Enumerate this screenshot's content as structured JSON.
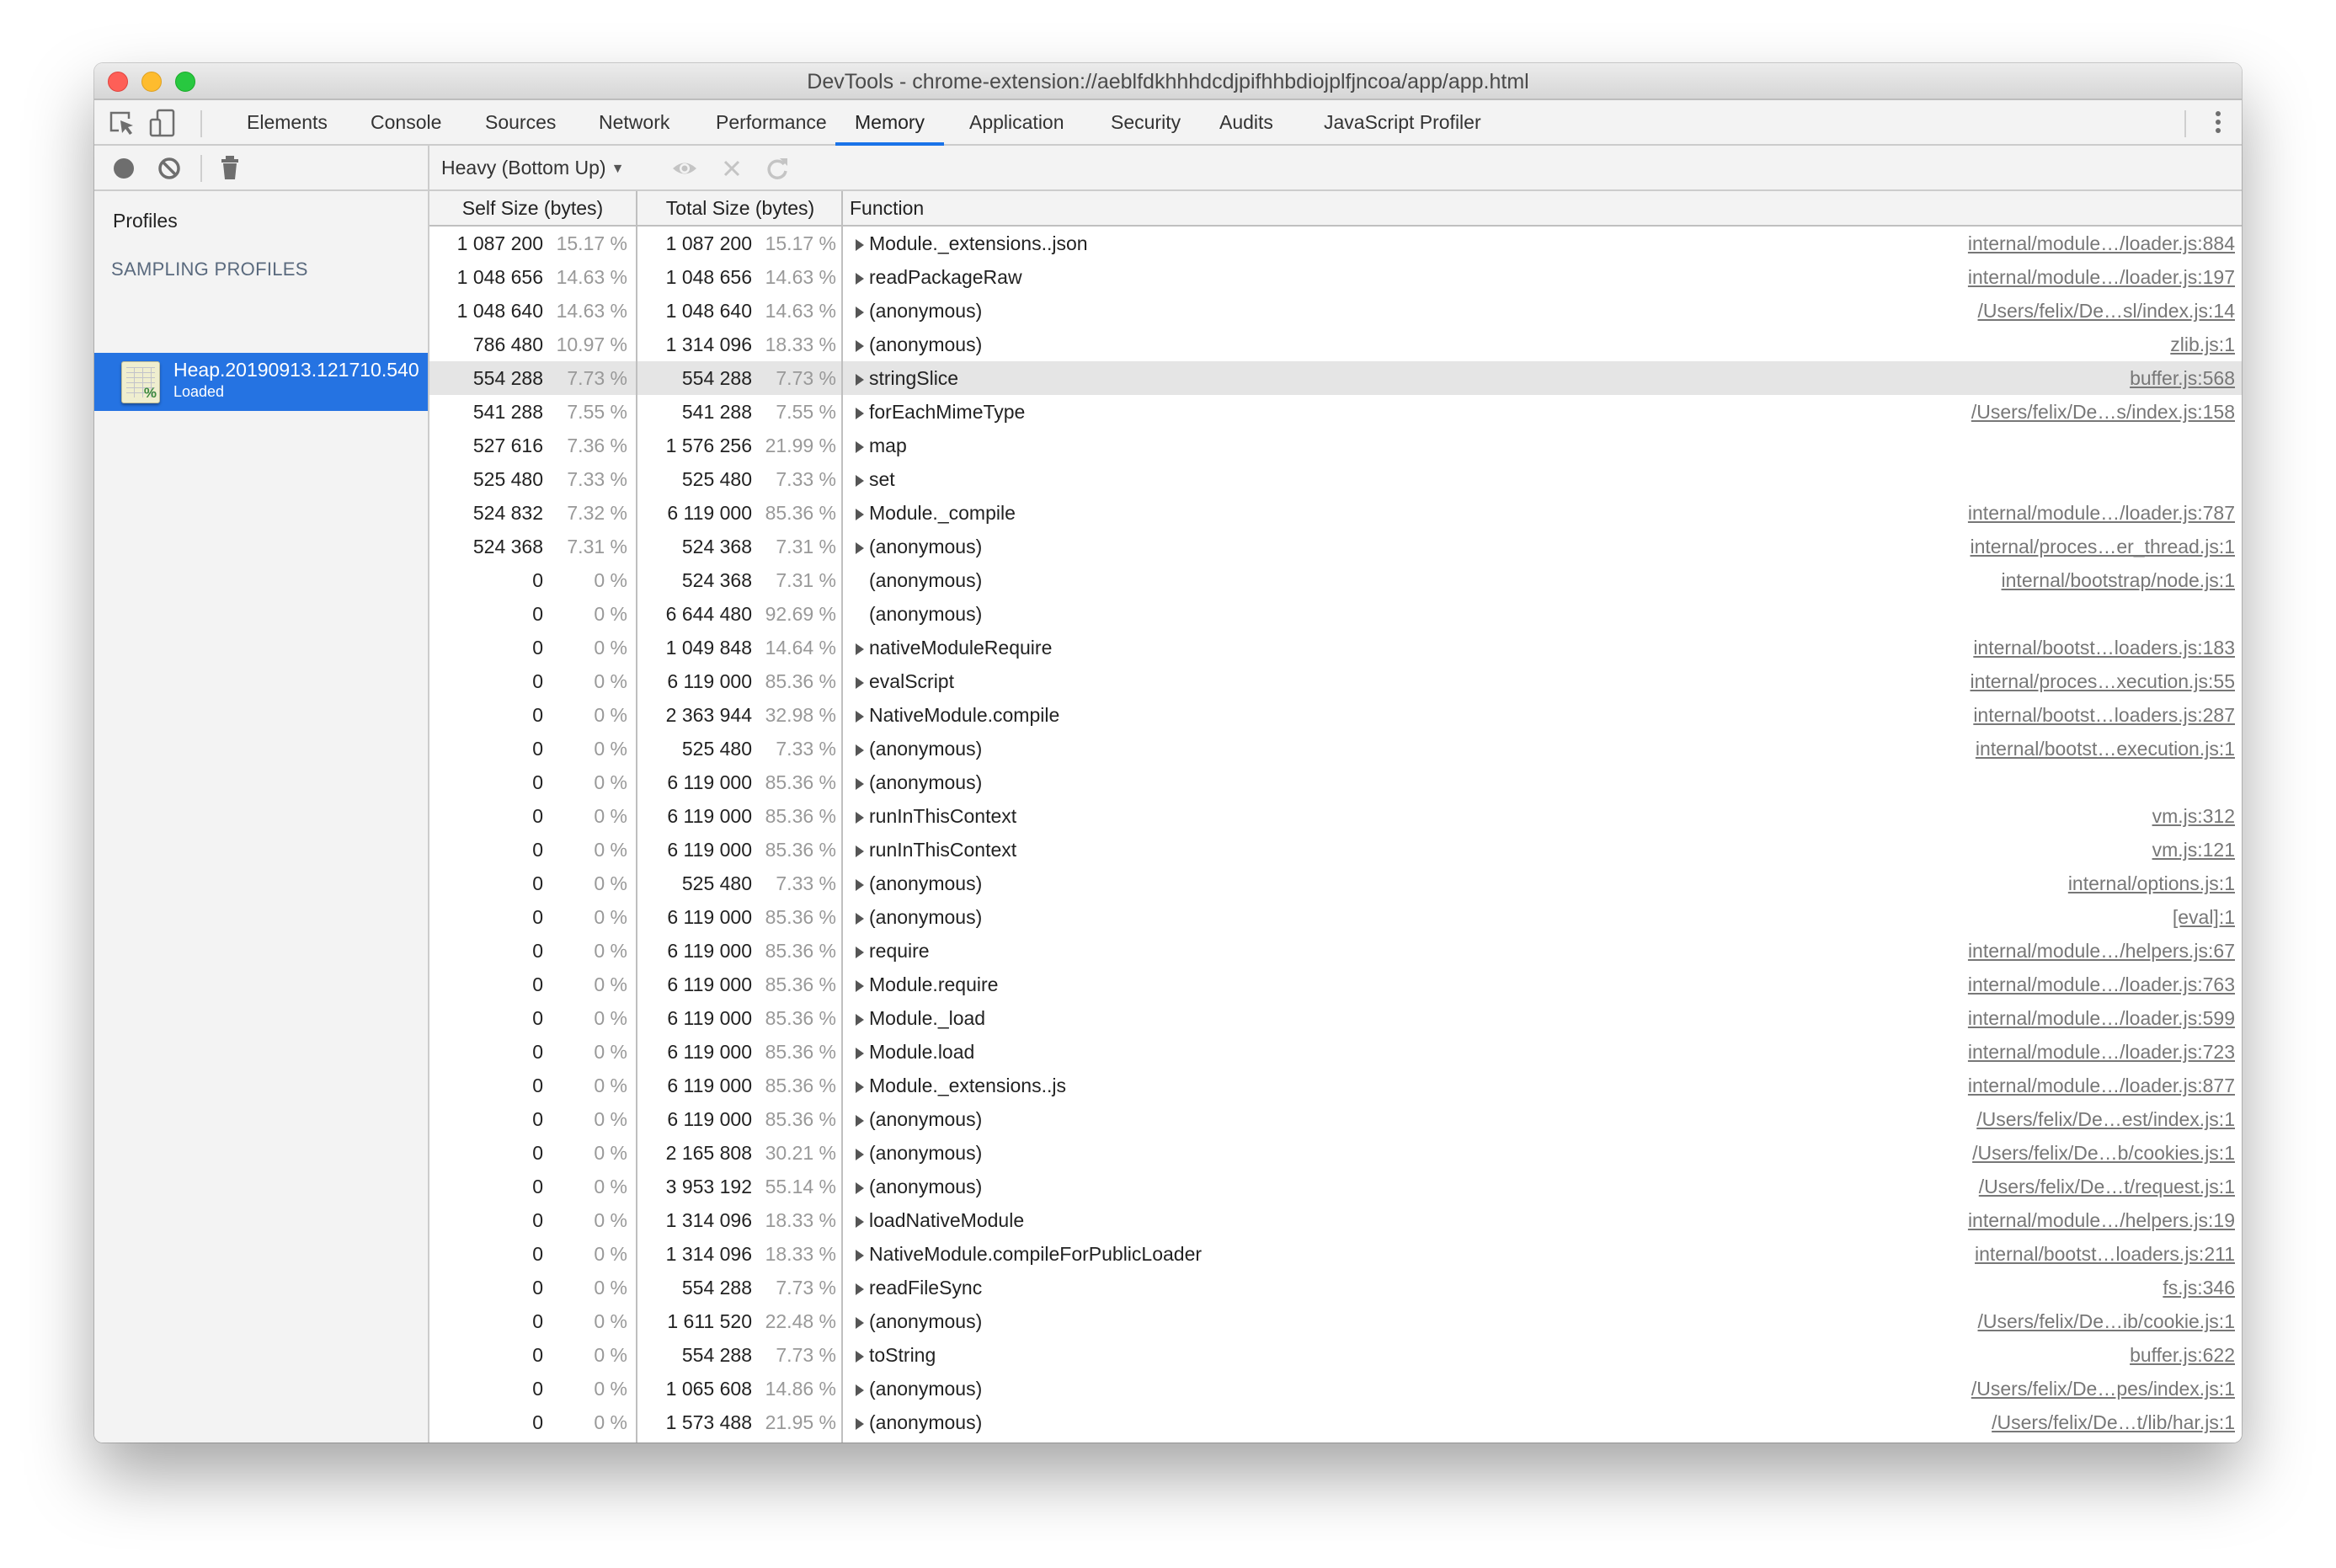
{
  "window": {
    "title": "DevTools - chrome-extension://aeblfdkhhhdcdjpifhhbdiojplfjncoa/app/app.html"
  },
  "tabbar": {
    "icons": [
      "inspect-element-icon",
      "device-toolbar-icon"
    ],
    "tabs": [
      {
        "label": "Elements"
      },
      {
        "label": "Console"
      },
      {
        "label": "Sources"
      },
      {
        "label": "Network"
      },
      {
        "label": "Performance"
      },
      {
        "label": "Memory",
        "active": true
      },
      {
        "label": "Application"
      },
      {
        "label": "Security"
      },
      {
        "label": "Audits"
      },
      {
        "label": "JavaScript Profiler"
      }
    ],
    "menu_icon": "kebab-menu-icon"
  },
  "toolbar": {
    "icons": [
      "record-icon",
      "clear-icon",
      "garbage-collect-icon"
    ],
    "view_mode": "Heavy (Bottom Up)",
    "view_icons": [
      "focus-eye-icon",
      "exclude-x-icon",
      "restore-reload-icon"
    ]
  },
  "sidebar": {
    "title": "Profiles",
    "section": "SAMPLING PROFILES",
    "profile": {
      "name": "Heap.20190913.121710.540",
      "status": "Loaded",
      "selected": true
    }
  },
  "table": {
    "columns": {
      "self": "Self Size (bytes)",
      "total": "Total Size (bytes)",
      "function": "Function"
    },
    "selected_row": 4,
    "rows": [
      {
        "self": "1 087 200",
        "self_pct": "15.17 %",
        "total": "1 087 200",
        "total_pct": "15.17 %",
        "fn": "Module._extensions..json",
        "expandable": true,
        "url": "internal/module…/loader.js:884"
      },
      {
        "self": "1 048 656",
        "self_pct": "14.63 %",
        "total": "1 048 656",
        "total_pct": "14.63 %",
        "fn": "readPackageRaw",
        "expandable": true,
        "url": "internal/module…/loader.js:197"
      },
      {
        "self": "1 048 640",
        "self_pct": "14.63 %",
        "total": "1 048 640",
        "total_pct": "14.63 %",
        "fn": "(anonymous)",
        "expandable": true,
        "url": "/Users/felix/De…sl/index.js:14"
      },
      {
        "self": "786 480",
        "self_pct": "10.97 %",
        "total": "1 314 096",
        "total_pct": "18.33 %",
        "fn": "(anonymous)",
        "expandable": true,
        "url": "zlib.js:1"
      },
      {
        "self": "554 288",
        "self_pct": "7.73 %",
        "total": "554 288",
        "total_pct": "7.73 %",
        "fn": "stringSlice",
        "expandable": true,
        "url": "buffer.js:568"
      },
      {
        "self": "541 288",
        "self_pct": "7.55 %",
        "total": "541 288",
        "total_pct": "7.55 %",
        "fn": "forEachMimeType",
        "expandable": true,
        "url": "/Users/felix/De…s/index.js:158"
      },
      {
        "self": "527 616",
        "self_pct": "7.36 %",
        "total": "1 576 256",
        "total_pct": "21.99 %",
        "fn": "map",
        "expandable": true,
        "url": ""
      },
      {
        "self": "525 480",
        "self_pct": "7.33 %",
        "total": "525 480",
        "total_pct": "7.33 %",
        "fn": "set",
        "expandable": true,
        "url": ""
      },
      {
        "self": "524 832",
        "self_pct": "7.32 %",
        "total": "6 119 000",
        "total_pct": "85.36 %",
        "fn": "Module._compile",
        "expandable": true,
        "url": "internal/module…/loader.js:787"
      },
      {
        "self": "524 368",
        "self_pct": "7.31 %",
        "total": "524 368",
        "total_pct": "7.31 %",
        "fn": "(anonymous)",
        "expandable": true,
        "url": "internal/proces…er_thread.js:1"
      },
      {
        "self": "0",
        "self_pct": "0 %",
        "total": "524 368",
        "total_pct": "7.31 %",
        "fn": "(anonymous)",
        "expandable": false,
        "url": "internal/bootstrap/node.js:1"
      },
      {
        "self": "0",
        "self_pct": "0 %",
        "total": "6 644 480",
        "total_pct": "92.69 %",
        "fn": "(anonymous)",
        "expandable": false,
        "url": ""
      },
      {
        "self": "0",
        "self_pct": "0 %",
        "total": "1 049 848",
        "total_pct": "14.64 %",
        "fn": "nativeModuleRequire",
        "expandable": true,
        "url": "internal/bootst…loaders.js:183"
      },
      {
        "self": "0",
        "self_pct": "0 %",
        "total": "6 119 000",
        "total_pct": "85.36 %",
        "fn": "evalScript",
        "expandable": true,
        "url": "internal/proces…xecution.js:55"
      },
      {
        "self": "0",
        "self_pct": "0 %",
        "total": "2 363 944",
        "total_pct": "32.98 %",
        "fn": "NativeModule.compile",
        "expandable": true,
        "url": "internal/bootst…loaders.js:287"
      },
      {
        "self": "0",
        "self_pct": "0 %",
        "total": "525 480",
        "total_pct": "7.33 %",
        "fn": "(anonymous)",
        "expandable": true,
        "url": "internal/bootst…execution.js:1"
      },
      {
        "self": "0",
        "self_pct": "0 %",
        "total": "6 119 000",
        "total_pct": "85.36 %",
        "fn": "(anonymous)",
        "expandable": true,
        "url": ""
      },
      {
        "self": "0",
        "self_pct": "0 %",
        "total": "6 119 000",
        "total_pct": "85.36 %",
        "fn": "runInThisContext",
        "expandable": true,
        "url": "vm.js:312"
      },
      {
        "self": "0",
        "self_pct": "0 %",
        "total": "6 119 000",
        "total_pct": "85.36 %",
        "fn": "runInThisContext",
        "expandable": true,
        "url": "vm.js:121"
      },
      {
        "self": "0",
        "self_pct": "0 %",
        "total": "525 480",
        "total_pct": "7.33 %",
        "fn": "(anonymous)",
        "expandable": true,
        "url": "internal/options.js:1"
      },
      {
        "self": "0",
        "self_pct": "0 %",
        "total": "6 119 000",
        "total_pct": "85.36 %",
        "fn": "(anonymous)",
        "expandable": true,
        "url": "[eval]:1"
      },
      {
        "self": "0",
        "self_pct": "0 %",
        "total": "6 119 000",
        "total_pct": "85.36 %",
        "fn": "require",
        "expandable": true,
        "url": "internal/module…/helpers.js:67"
      },
      {
        "self": "0",
        "self_pct": "0 %",
        "total": "6 119 000",
        "total_pct": "85.36 %",
        "fn": "Module.require",
        "expandable": true,
        "url": "internal/module…/loader.js:763"
      },
      {
        "self": "0",
        "self_pct": "0 %",
        "total": "6 119 000",
        "total_pct": "85.36 %",
        "fn": "Module._load",
        "expandable": true,
        "url": "internal/module…/loader.js:599"
      },
      {
        "self": "0",
        "self_pct": "0 %",
        "total": "6 119 000",
        "total_pct": "85.36 %",
        "fn": "Module.load",
        "expandable": true,
        "url": "internal/module…/loader.js:723"
      },
      {
        "self": "0",
        "self_pct": "0 %",
        "total": "6 119 000",
        "total_pct": "85.36 %",
        "fn": "Module._extensions..js",
        "expandable": true,
        "url": "internal/module…/loader.js:877"
      },
      {
        "self": "0",
        "self_pct": "0 %",
        "total": "6 119 000",
        "total_pct": "85.36 %",
        "fn": "(anonymous)",
        "expandable": true,
        "url": "/Users/felix/De…est/index.js:1"
      },
      {
        "self": "0",
        "self_pct": "0 %",
        "total": "2 165 808",
        "total_pct": "30.21 %",
        "fn": "(anonymous)",
        "expandable": true,
        "url": "/Users/felix/De…b/cookies.js:1"
      },
      {
        "self": "0",
        "self_pct": "0 %",
        "total": "3 953 192",
        "total_pct": "55.14 %",
        "fn": "(anonymous)",
        "expandable": true,
        "url": "/Users/felix/De…t/request.js:1"
      },
      {
        "self": "0",
        "self_pct": "0 %",
        "total": "1 314 096",
        "total_pct": "18.33 %",
        "fn": "loadNativeModule",
        "expandable": true,
        "url": "internal/module…/helpers.js:19"
      },
      {
        "self": "0",
        "self_pct": "0 %",
        "total": "1 314 096",
        "total_pct": "18.33 %",
        "fn": "NativeModule.compileForPublicLoader",
        "expandable": true,
        "url": "internal/bootst…loaders.js:211"
      },
      {
        "self": "0",
        "self_pct": "0 %",
        "total": "554 288",
        "total_pct": "7.73 %",
        "fn": "readFileSync",
        "expandable": true,
        "url": "fs.js:346"
      },
      {
        "self": "0",
        "self_pct": "0 %",
        "total": "1 611 520",
        "total_pct": "22.48 %",
        "fn": "(anonymous)",
        "expandable": true,
        "url": "/Users/felix/De…ib/cookie.js:1"
      },
      {
        "self": "0",
        "self_pct": "0 %",
        "total": "554 288",
        "total_pct": "7.73 %",
        "fn": "toString",
        "expandable": true,
        "url": "buffer.js:622"
      },
      {
        "self": "0",
        "self_pct": "0 %",
        "total": "1 065 608",
        "total_pct": "14.86 %",
        "fn": "(anonymous)",
        "expandable": true,
        "url": "/Users/felix/De…pes/index.js:1"
      },
      {
        "self": "0",
        "self_pct": "0 %",
        "total": "1 573 488",
        "total_pct": "21.95 %",
        "fn": "(anonymous)",
        "expandable": true,
        "url": "/Users/felix/De…t/lib/har.js:1"
      }
    ]
  }
}
